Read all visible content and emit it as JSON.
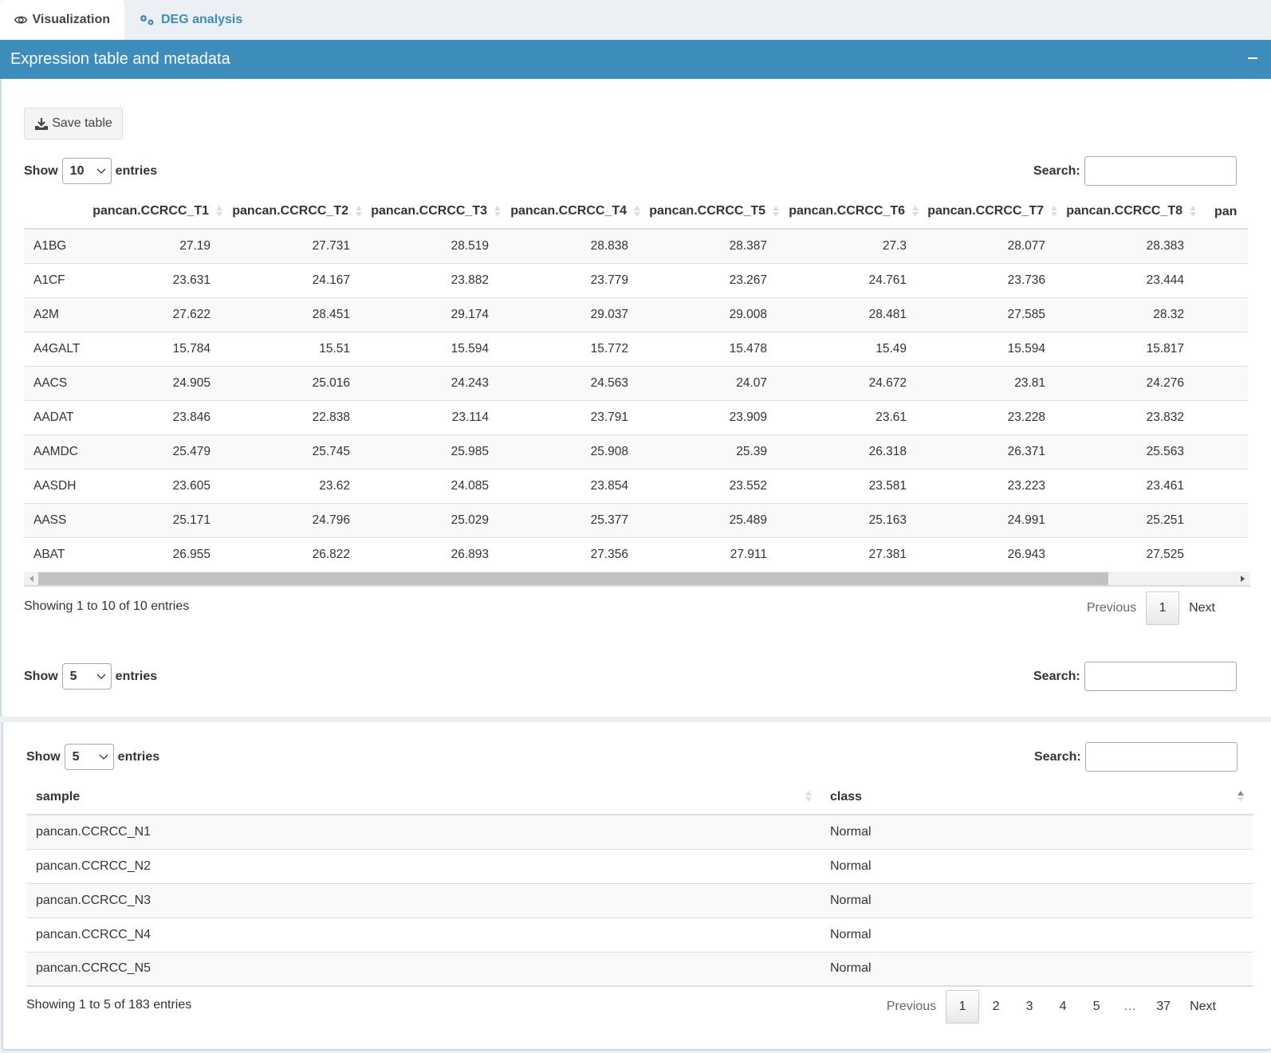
{
  "tabs": [
    {
      "label": "Visualization",
      "icon": "eye-icon",
      "active": true
    },
    {
      "label": "DEG analysis",
      "icon": "cogs-icon",
      "active": false
    }
  ],
  "box": {
    "title": "Expression table and metadata",
    "collapse_icon": "minus-icon",
    "accent_color": "#3c8dbc"
  },
  "save_button": {
    "label": "Save table",
    "icon": "download-icon"
  },
  "expression_table": {
    "length_label_pre": "Show",
    "length_value": "10",
    "length_label_post": "entries",
    "search_label": "Search:",
    "search_value": "",
    "columns": [
      "",
      "pancan.CCRCC_T1",
      "pancan.CCRCC_T2",
      "pancan.CCRCC_T3",
      "pancan.CCRCC_T4",
      "pancan.CCRCC_T5",
      "pancan.CCRCC_T6",
      "pancan.CCRCC_T7",
      "pancan.CCRCC_T8",
      "pan"
    ],
    "rows": [
      [
        "A1BG",
        "27.19",
        "27.731",
        "28.519",
        "28.838",
        "28.387",
        "27.3",
        "28.077",
        "28.383"
      ],
      [
        "A1CF",
        "23.631",
        "24.167",
        "23.882",
        "23.779",
        "23.267",
        "24.761",
        "23.736",
        "23.444"
      ],
      [
        "A2M",
        "27.622",
        "28.451",
        "29.174",
        "29.037",
        "29.008",
        "28.481",
        "27.585",
        "28.32"
      ],
      [
        "A4GALT",
        "15.784",
        "15.51",
        "15.594",
        "15.772",
        "15.478",
        "15.49",
        "15.594",
        "15.817"
      ],
      [
        "AACS",
        "24.905",
        "25.016",
        "24.243",
        "24.563",
        "24.07",
        "24.672",
        "23.81",
        "24.276"
      ],
      [
        "AADAT",
        "23.846",
        "22.838",
        "23.114",
        "23.791",
        "23.909",
        "23.61",
        "23.228",
        "23.832"
      ],
      [
        "AAMDC",
        "25.479",
        "25.745",
        "25.985",
        "25.908",
        "25.39",
        "26.318",
        "26.371",
        "25.563"
      ],
      [
        "AASDH",
        "23.605",
        "23.62",
        "24.085",
        "23.854",
        "23.552",
        "23.581",
        "23.223",
        "23.461"
      ],
      [
        "AASS",
        "25.171",
        "24.796",
        "25.029",
        "25.377",
        "25.489",
        "25.163",
        "24.991",
        "25.251"
      ],
      [
        "ABAT",
        "26.955",
        "26.822",
        "26.893",
        "27.356",
        "27.911",
        "27.381",
        "26.943",
        "27.525"
      ]
    ],
    "info": "Showing 1 to 10 of 10 entries",
    "pagination": {
      "previous": "Previous",
      "pages": [
        "1"
      ],
      "current": "1",
      "next": "Next"
    }
  },
  "empty_table": {
    "length_label_pre": "Show",
    "length_value": "5",
    "length_label_post": "entries",
    "search_label": "Search:",
    "search_value": ""
  },
  "metadata_table": {
    "length_label_pre": "Show",
    "length_value": "5",
    "length_label_post": "entries",
    "search_label": "Search:",
    "search_value": "",
    "columns": [
      "sample",
      "class"
    ],
    "rows": [
      [
        "pancan.CCRCC_N1",
        "Normal"
      ],
      [
        "pancan.CCRCC_N2",
        "Normal"
      ],
      [
        "pancan.CCRCC_N3",
        "Normal"
      ],
      [
        "pancan.CCRCC_N4",
        "Normal"
      ],
      [
        "pancan.CCRCC_N5",
        "Normal"
      ]
    ],
    "info": "Showing 1 to 5 of 183 entries",
    "pagination": {
      "previous": "Previous",
      "pages": [
        "1",
        "2",
        "3",
        "4",
        "5",
        "…",
        "37"
      ],
      "current": "1",
      "next": "Next"
    }
  }
}
